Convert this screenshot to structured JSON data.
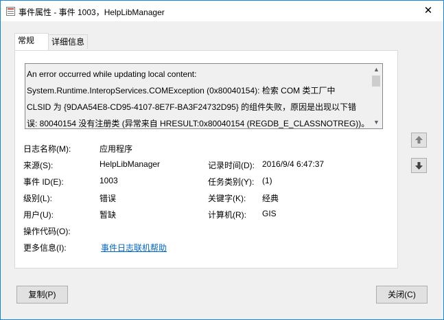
{
  "window": {
    "title": "事件属性 - 事件 1003，HelpLibManager",
    "close_icon": "close-icon"
  },
  "tabs": [
    {
      "label": "常规",
      "active": true
    },
    {
      "label": "详细信息",
      "active": false
    }
  ],
  "description": "An error occurred while updating local content:\nSystem.Runtime.InteropServices.COMException (0x80040154): 检索 COM 类工厂中\nCLSID 为 {9DAA54E8-CD95-4107-8E7F-BA3F24732D95} 的组件失败，原因是出现以下错\n误: 80040154 没有注册类 (异常来自 HRESULT:0x80040154 (REGDB_E_CLASSNOTREG))。",
  "fields": {
    "log_name_label": "日志名称(M):",
    "log_name_value": "应用程序",
    "source_label": "来源(S):",
    "source_value": "HelpLibManager",
    "logged_label": "记录时间(D):",
    "logged_value": "2016/9/4 6:47:37",
    "event_id_label": "事件 ID(E):",
    "event_id_value": "1003",
    "task_category_label": "任务类别(Y):",
    "task_category_value": "(1)",
    "level_label": "级别(L):",
    "level_value": "错误",
    "keywords_label": "关键字(K):",
    "keywords_value": "经典",
    "user_label": "用户(U):",
    "user_value": "暂缺",
    "computer_label": "计算机(R):",
    "computer_value": "GIS",
    "opcode_label": "操作代码(O):",
    "opcode_value": "",
    "more_info_label": "更多信息(I):",
    "more_info_link": "事件日志联机帮助"
  },
  "buttons": {
    "copy": "复制(P)",
    "close": "关闭(C)",
    "prev_icon": "arrow-up-icon",
    "next_icon": "arrow-down-icon"
  }
}
